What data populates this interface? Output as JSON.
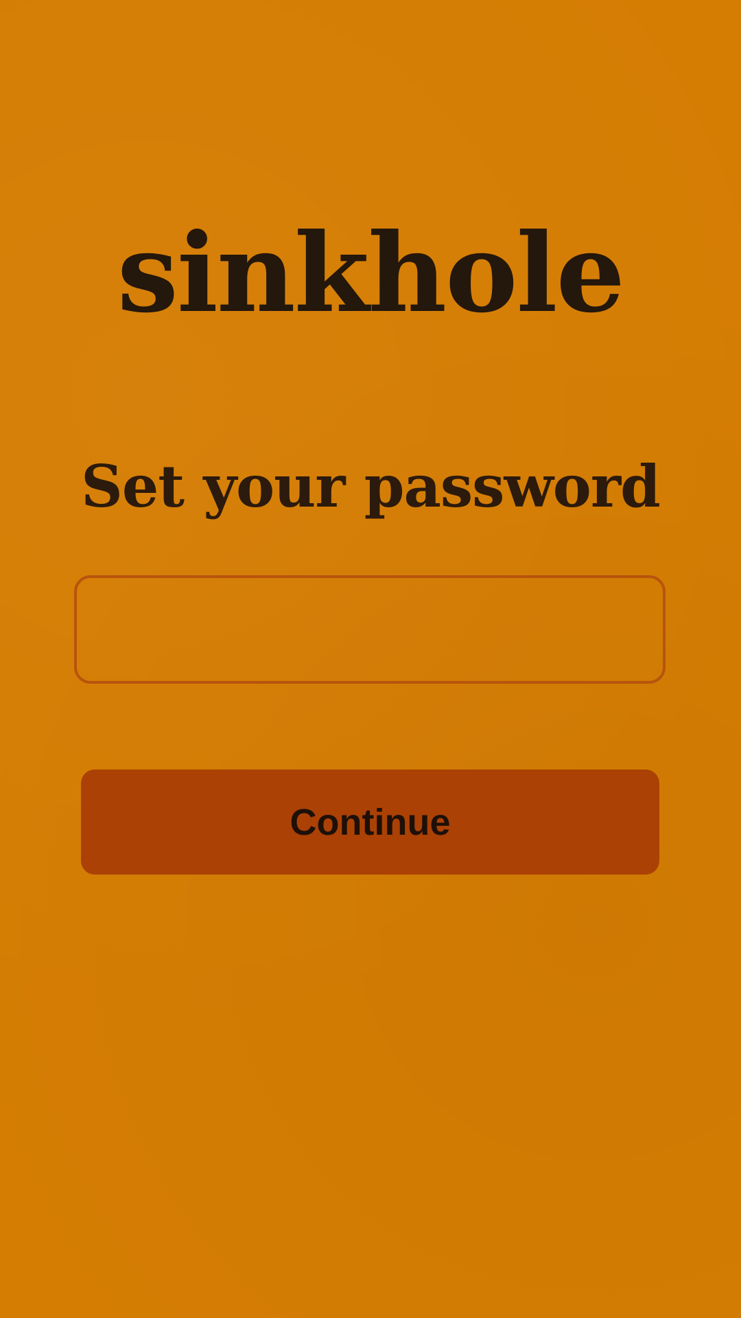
{
  "app": {
    "brand": "sinkhole"
  },
  "form": {
    "title": "Set your password",
    "password_value": "",
    "password_placeholder": "",
    "submit_label": "Continue"
  },
  "colors": {
    "background": "#D57D03",
    "text": "#24170C",
    "field_border": "#B8540C",
    "button_background": "#AB4105"
  }
}
